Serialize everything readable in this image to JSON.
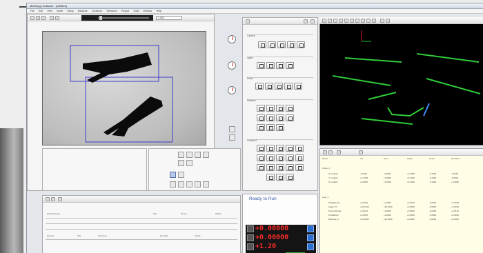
{
  "window": {
    "title": "Metrology Software - [Untitled]",
    "menu": [
      "File",
      "Edit",
      "View",
      "Insert",
      "Setup",
      "Measure",
      "Construct",
      "Tolerance",
      "Report",
      "Tools",
      "Window",
      "Help"
    ]
  },
  "camera": {
    "toolbar_icons": [
      "new-icon",
      "open-icon",
      "save-icon",
      "camera-icon",
      "light-icon"
    ],
    "zoom_value": "1.000"
  },
  "nav": {
    "dials": [
      "x-axis-dial",
      "y-axis-dial",
      "z-axis-dial"
    ]
  },
  "palette": {
    "sections": [
      {
        "label": "Camera"
      },
      {
        "label": "Lights"
      },
      {
        "label": "Probe"
      },
      {
        "label": "Features"
      },
      {
        "label": "Construct"
      }
    ]
  },
  "results": {
    "header": [
      "Name",
      "Act",
      "Nom",
      "Upper",
      "Lower",
      "Deviation"
    ],
    "rows": [
      [
        "Circle_1",
        "",
        "",
        "",
        "",
        ""
      ],
      [
        "X Location",
        "-3.0215",
        "-3.0000",
        "+0.1000",
        "-0.1000",
        "-0.0215"
      ],
      [
        "Y Location",
        "+3.4468",
        "+3.5000",
        "+0.1000",
        "-0.1000",
        "-0.0532"
      ],
      [
        "Z Location",
        "+0.0000",
        "+0.0000",
        "+0.1000",
        "-0.1000",
        "+0.0000"
      ],
      [
        "Line_1",
        "",
        "",
        "",
        "",
        ""
      ],
      [
        "Straightness",
        "+0.0033",
        "+0.0000",
        "+0.0100",
        "-0.0000",
        "+0.0033"
      ],
      [
        "Angle XY",
        "+45.2310",
        "+45.0000",
        "+0.5000",
        "-0.5000",
        "+0.2310"
      ],
      [
        "Perpendicular",
        "+0.0120",
        "+0.0000",
        "+0.0500",
        "-0.0000",
        "+0.0120"
      ],
      [
        "Parallelism",
        "+0.0045",
        "+0.0000",
        "+0.0500",
        "-0.0000",
        "+0.0045"
      ],
      [
        "Distance_1",
        "+12.5004",
        "+12.5000",
        "+0.0200",
        "-0.0200",
        "+0.0004"
      ]
    ]
  },
  "log": {
    "header": [
      "Feature Name",
      "Hits",
      "Result",
      "Status"
    ],
    "row": [
      "Feature",
      "Hits",
      "Tolerance",
      "Nominal",
      "Actual"
    ]
  },
  "status": {
    "text": "Ready to Run",
    "readouts": [
      {
        "value": "+0.00000",
        "axis": "X"
      },
      {
        "value": "+0.00000",
        "axis": "Y"
      },
      {
        "value": "+1.20",
        "axis": "Z"
      }
    ]
  }
}
